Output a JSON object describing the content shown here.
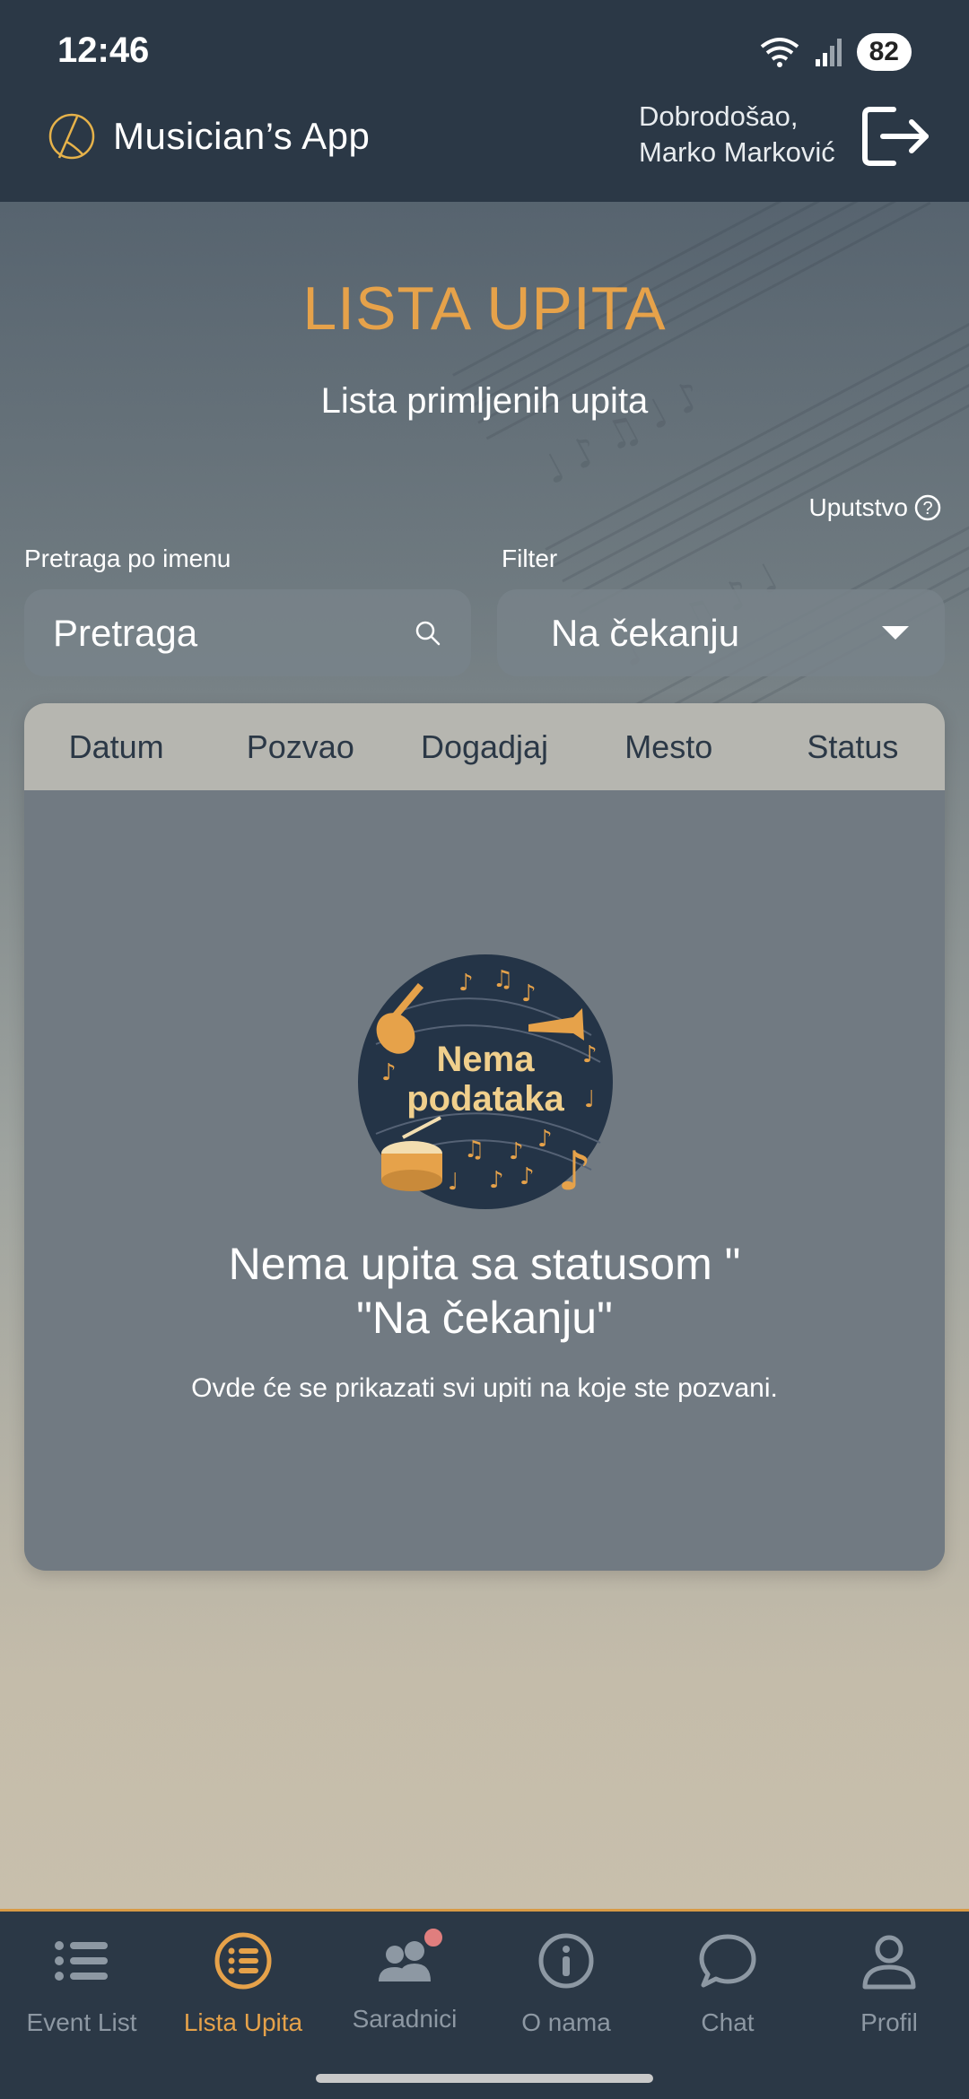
{
  "status_bar": {
    "time": "12:46",
    "battery": "82"
  },
  "header": {
    "app_name": "Musician’s App",
    "welcome_line1": "Dobrodošao,",
    "welcome_line2": "Marko Marković",
    "logout_icon": "logout-icon"
  },
  "page": {
    "title": "LISTA UPITA",
    "subtitle": "Lista primljenih upita",
    "help_label": "Uputstvo"
  },
  "search": {
    "label": "Pretraga po imenu",
    "placeholder": "Pretraga"
  },
  "filter": {
    "label": "Filter",
    "selected": "Na čekanju"
  },
  "table": {
    "columns": [
      "Datum",
      "Pozvao",
      "Dogadjaj",
      "Mesto",
      "Status"
    ],
    "empty_badge_line1": "Nema",
    "empty_badge_line2": "podataka",
    "empty_title_line1": "Nema upita sa statusom \"",
    "empty_title_line2": "\"Na čekanju\"",
    "empty_desc": "Ovde će se prikazati svi upiti na koje ste pozvani."
  },
  "nav": {
    "items": [
      {
        "label": "Event List",
        "icon": "list-icon"
      },
      {
        "label": "Lista Upita",
        "icon": "circle-list-icon",
        "active": true
      },
      {
        "label": "Saradnici",
        "icon": "users-icon",
        "badge": true
      },
      {
        "label": "O nama",
        "icon": "info-icon"
      },
      {
        "label": "Chat",
        "icon": "chat-icon"
      },
      {
        "label": "Profil",
        "icon": "person-icon"
      }
    ]
  },
  "colors": {
    "accent": "#e6a24a",
    "header_bg": "#2b3846",
    "card_bg": "#717a82",
    "table_head_bg": "#b6b6b0",
    "notification_dot": "#e07e7e"
  }
}
